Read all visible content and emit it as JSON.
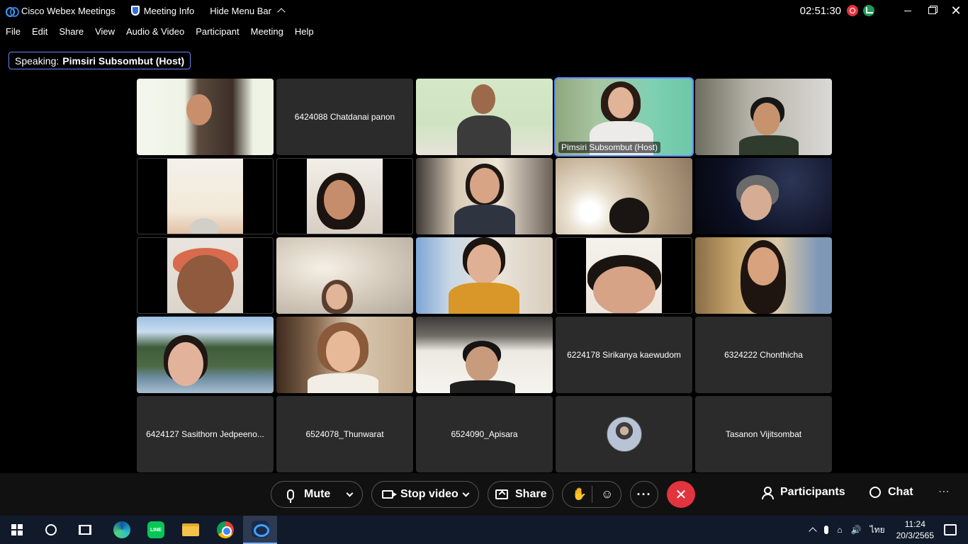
{
  "titlebar": {
    "app_name": "Cisco Webex Meetings",
    "meeting_info": "Meeting Info",
    "hide_menu": "Hide Menu Bar",
    "clock": "02:51:30",
    "close_glyph": "✕"
  },
  "menu": [
    "File",
    "Edit",
    "Share",
    "View",
    "Audio & Video",
    "Participant",
    "Meeting",
    "Help"
  ],
  "speaking": {
    "prefix": "Speaking:",
    "name": "Pimsiri Subsombut (Host)"
  },
  "tiles": [
    {
      "kind": "video",
      "label": ""
    },
    {
      "kind": "name",
      "label": "6424088 Chatdanai panon"
    },
    {
      "kind": "video",
      "label": ""
    },
    {
      "kind": "video",
      "label": "Pimsiri Subsombut (Host)"
    },
    {
      "kind": "video",
      "label": ""
    },
    {
      "kind": "video",
      "label": ""
    },
    {
      "kind": "video",
      "label": ""
    },
    {
      "kind": "video",
      "label": ""
    },
    {
      "kind": "video",
      "label": ""
    },
    {
      "kind": "video",
      "label": ""
    },
    {
      "kind": "video",
      "label": ""
    },
    {
      "kind": "video",
      "label": ""
    },
    {
      "kind": "video",
      "label": ""
    },
    {
      "kind": "video",
      "label": ""
    },
    {
      "kind": "video",
      "label": ""
    },
    {
      "kind": "video",
      "label": ""
    },
    {
      "kind": "video",
      "label": ""
    },
    {
      "kind": "video",
      "label": ""
    },
    {
      "kind": "name",
      "label": "6224178 Sirikanya kaewudom"
    },
    {
      "kind": "name",
      "label": "6324222 Chonthicha"
    },
    {
      "kind": "name",
      "label": "6424127 Sasithorn Jedpeeno..."
    },
    {
      "kind": "name",
      "label": "6524078_Thunwarat"
    },
    {
      "kind": "name",
      "label": "6524090_Apisara"
    },
    {
      "kind": "avatar",
      "label": ""
    },
    {
      "kind": "name",
      "label": "Tasanon Vijitsombat"
    }
  ],
  "controls": {
    "mute": "Mute",
    "stop_video": "Stop video",
    "share": "Share",
    "more": "···",
    "leave": "✕",
    "participants": "Participants",
    "chat": "Chat",
    "overflow": "⋯",
    "hand_icon": "✋",
    "reaction_icon": "☺"
  },
  "taskbar": {
    "line_label": "LINE",
    "tray_caret": "^",
    "tray_network": "⌂",
    "tray_volume": "🔊",
    "language": "ไทย",
    "time": "11:24",
    "date": "20/3/2565"
  },
  "colors": {
    "accent": "#5d8dff",
    "leave_red": "#e2343f",
    "record_red": "#e2343f",
    "stats_green": "#1c9b5a"
  }
}
